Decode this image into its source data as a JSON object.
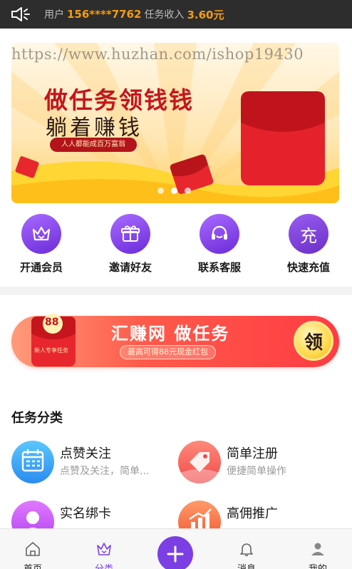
{
  "topbar": {
    "user_label": "用户",
    "phone": "156****7762",
    "income_label": "任务收入",
    "income_value": "3.60元"
  },
  "banner": {
    "watermark": "https://www.huzhan.com/ishop19430",
    "title_main": "做任务领钱钱",
    "title_sub": "躺着赚钱",
    "tagline": "人人都能成百万富翁",
    "slide_count": 3,
    "active_slide": 2
  },
  "quick_menu": [
    {
      "label": "开通会员",
      "icon": "crown-icon"
    },
    {
      "label": "邀请好友",
      "icon": "gift-icon"
    },
    {
      "label": "联系客服",
      "icon": "headset-icon"
    },
    {
      "label": "快速充值",
      "icon": "recharge-icon",
      "glyph": "充"
    }
  ],
  "promo": {
    "title": "汇赚网 做任务",
    "subtitle": "最高可得88元现金红包",
    "badge": "领",
    "envelope_number": "88",
    "envelope_caption": "新人专享任务"
  },
  "section": {
    "title": "任务分类"
  },
  "categories": [
    {
      "name": "点赞关注",
      "desc": "点赞及关注，简单...",
      "icon": "calendar-icon"
    },
    {
      "name": "简单注册",
      "desc": "便捷简单操作",
      "icon": "tag-icon"
    },
    {
      "name": "实名绑卡",
      "desc": "",
      "icon": "user-icon"
    },
    {
      "name": "高佣推广",
      "desc": "",
      "icon": "chart-icon"
    }
  ],
  "bottom_nav": [
    {
      "label": "首页",
      "icon": "home-icon"
    },
    {
      "label": "分类",
      "icon": "crown-icon",
      "active": true
    },
    {
      "label": "消息",
      "icon": "bell-icon"
    },
    {
      "label": "我的",
      "icon": "user-icon"
    }
  ],
  "colors": {
    "accent": "#7b3fe4",
    "income": "#f39c12",
    "banner_red": "#c3161c"
  }
}
